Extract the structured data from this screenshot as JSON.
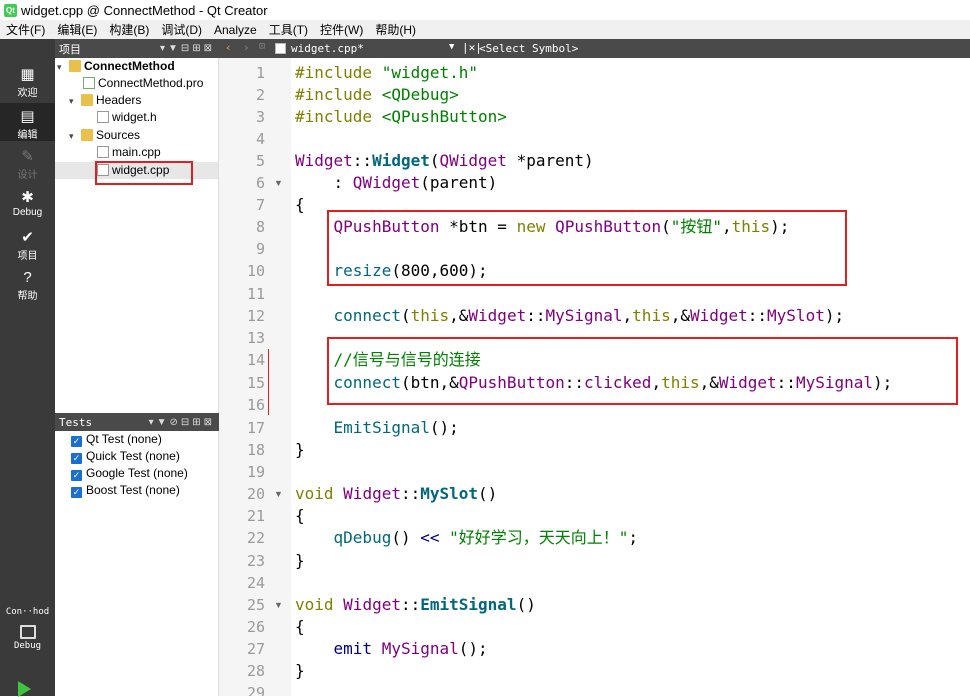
{
  "window": {
    "title": "widget.cpp @ ConnectMethod - Qt Creator",
    "logo": "Qt"
  },
  "menu": [
    "文件(F)",
    "编辑(E)",
    "构建(B)",
    "调试(D)",
    "Analyze",
    "工具(T)",
    "控件(W)",
    "帮助(H)"
  ],
  "modes": [
    {
      "label": "欢迎",
      "icon": "grid-icon"
    },
    {
      "label": "编辑",
      "icon": "edit-icon"
    },
    {
      "label": "设计",
      "icon": "pen-icon"
    },
    {
      "label": "Debug",
      "icon": "bug-icon"
    },
    {
      "label": "项目",
      "icon": "wrench-icon"
    },
    {
      "label": "帮助",
      "icon": "help-icon"
    }
  ],
  "kit": {
    "project": "Con··hod",
    "label": "Debug"
  },
  "project_panel": {
    "title": "项目",
    "tree": {
      "root": "ConnectMethod",
      "pro": "ConnectMethod.pro",
      "headers": "Headers",
      "header_files": [
        "widget.h"
      ],
      "sources": "Sources",
      "source_files": [
        "main.cpp",
        "widget.cpp"
      ]
    }
  },
  "tests_panel": {
    "title": "Tests",
    "items": [
      "Qt Test (none)",
      "Quick Test (none)",
      "Google Test (none)",
      "Boost Test (none)"
    ]
  },
  "editor": {
    "tab": "widget.cpp*",
    "symbol": "<Select Symbol>",
    "line_numbers": [
      "1",
      "2",
      "3",
      "4",
      "5",
      "6",
      "7",
      "8",
      "9",
      "10",
      "11",
      "12",
      "13",
      "14",
      "15",
      "16",
      "17",
      "18",
      "19",
      "20",
      "21",
      "22",
      "23",
      "24",
      "25",
      "26",
      "27",
      "28",
      "29"
    ]
  },
  "colors": {
    "highlight": "#e02020",
    "keyword": "#808000",
    "string": "#008000",
    "type": "#800080",
    "function": "#00677c"
  }
}
